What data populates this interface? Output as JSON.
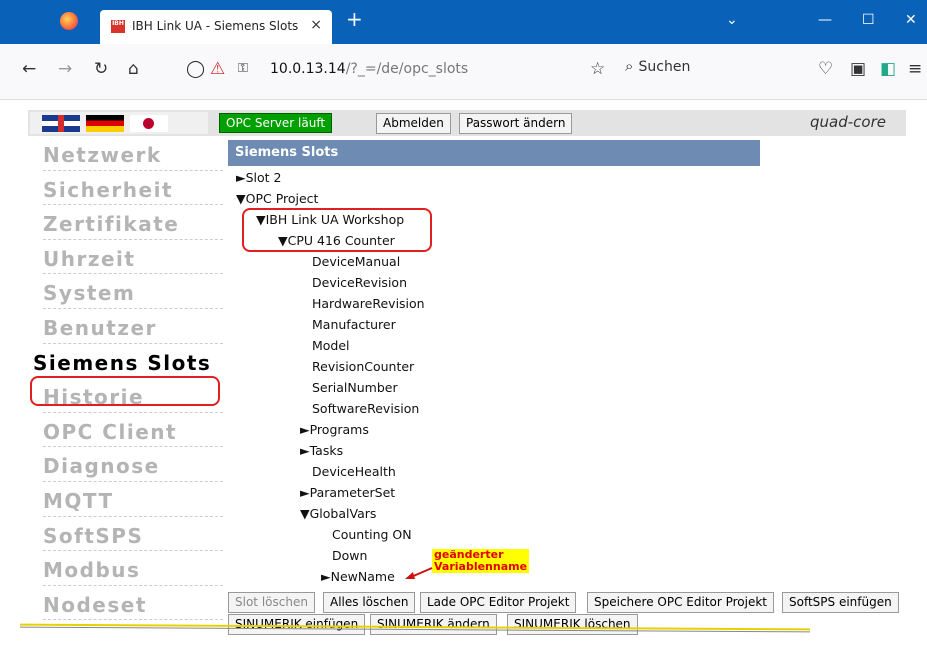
{
  "browser": {
    "tab_title": "IBH Link UA - Siemens Slots",
    "tab_close": "×",
    "new_tab": "+",
    "url_host": "10.0.13.14",
    "url_path": "/?_=/de/opc_slots",
    "search_placeholder": "Suchen",
    "favicon_text": "IBH"
  },
  "header": {
    "opc_status": "OPC Server läuft",
    "logout": "Abmelden",
    "change_password": "Passwort ändern",
    "brand": "quad-core"
  },
  "sidebar": {
    "items": [
      {
        "label": "Netzwerk"
      },
      {
        "label": "Sicherheit"
      },
      {
        "label": "Zertifikate"
      },
      {
        "label": "Uhrzeit"
      },
      {
        "label": "System"
      },
      {
        "label": "Benutzer"
      },
      {
        "label": "Siemens Slots",
        "active": true
      },
      {
        "label": "Historie"
      },
      {
        "label": "OPC Client"
      },
      {
        "label": "Diagnose"
      },
      {
        "label": "MQTT"
      },
      {
        "label": "SoftSPS"
      },
      {
        "label": "Modbus"
      },
      {
        "label": "Nodeset"
      }
    ]
  },
  "panel": {
    "title": "Siemens Slots",
    "tree": [
      {
        "label": "►Slot 2"
      },
      {
        "label": "▼OPC Project"
      },
      {
        "label": "▼IBH Link UA Workshop"
      },
      {
        "label": "▼CPU 416 Counter"
      },
      {
        "label": "DeviceManual"
      },
      {
        "label": "DeviceRevision"
      },
      {
        "label": "HardwareRevision"
      },
      {
        "label": "Manufacturer"
      },
      {
        "label": "Model"
      },
      {
        "label": "RevisionCounter"
      },
      {
        "label": "SerialNumber"
      },
      {
        "label": "SoftwareRevision"
      },
      {
        "label": "►Programs"
      },
      {
        "label": "►Tasks"
      },
      {
        "label": "DeviceHealth"
      },
      {
        "label": "►ParameterSet"
      },
      {
        "label": "▼GlobalVars"
      },
      {
        "label": "Counting ON"
      },
      {
        "label": "Down"
      },
      {
        "label": "►NewName"
      }
    ],
    "annotation_line1": "geänderter",
    "annotation_line2": "Variablenname"
  },
  "buttons": {
    "row1": [
      "Slot löschen",
      "Alles löschen",
      "Lade OPC Editor Projekt",
      "Speichere OPC Editor Projekt",
      "SoftSPS einfügen"
    ],
    "row2": [
      "SINUMERIK einfügen",
      "SINUMERIK ändern",
      "SINUMERIK löschen"
    ]
  }
}
